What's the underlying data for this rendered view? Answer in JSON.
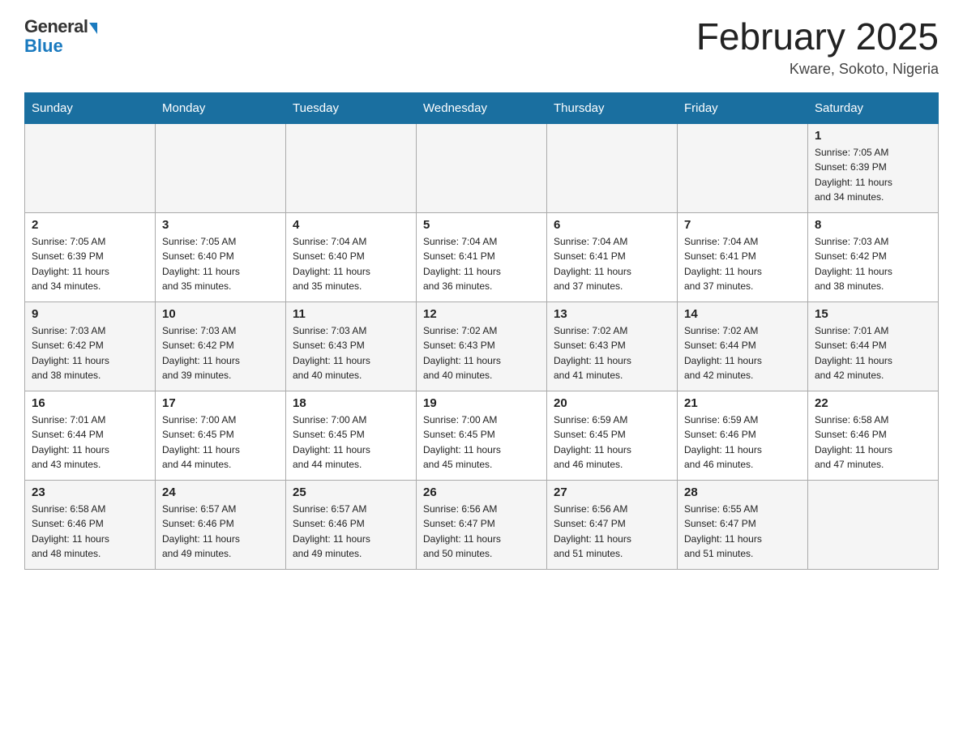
{
  "header": {
    "logo_general": "General",
    "logo_blue": "Blue",
    "title": "February 2025",
    "subtitle": "Kware, Sokoto, Nigeria"
  },
  "days_of_week": [
    "Sunday",
    "Monday",
    "Tuesday",
    "Wednesday",
    "Thursday",
    "Friday",
    "Saturday"
  ],
  "weeks": [
    {
      "row_class": "row-odd",
      "days": [
        {
          "num": "",
          "info": ""
        },
        {
          "num": "",
          "info": ""
        },
        {
          "num": "",
          "info": ""
        },
        {
          "num": "",
          "info": ""
        },
        {
          "num": "",
          "info": ""
        },
        {
          "num": "",
          "info": ""
        },
        {
          "num": "1",
          "info": "Sunrise: 7:05 AM\nSunset: 6:39 PM\nDaylight: 11 hours\nand 34 minutes."
        }
      ]
    },
    {
      "row_class": "row-even",
      "days": [
        {
          "num": "2",
          "info": "Sunrise: 7:05 AM\nSunset: 6:39 PM\nDaylight: 11 hours\nand 34 minutes."
        },
        {
          "num": "3",
          "info": "Sunrise: 7:05 AM\nSunset: 6:40 PM\nDaylight: 11 hours\nand 35 minutes."
        },
        {
          "num": "4",
          "info": "Sunrise: 7:04 AM\nSunset: 6:40 PM\nDaylight: 11 hours\nand 35 minutes."
        },
        {
          "num": "5",
          "info": "Sunrise: 7:04 AM\nSunset: 6:41 PM\nDaylight: 11 hours\nand 36 minutes."
        },
        {
          "num": "6",
          "info": "Sunrise: 7:04 AM\nSunset: 6:41 PM\nDaylight: 11 hours\nand 37 minutes."
        },
        {
          "num": "7",
          "info": "Sunrise: 7:04 AM\nSunset: 6:41 PM\nDaylight: 11 hours\nand 37 minutes."
        },
        {
          "num": "8",
          "info": "Sunrise: 7:03 AM\nSunset: 6:42 PM\nDaylight: 11 hours\nand 38 minutes."
        }
      ]
    },
    {
      "row_class": "row-odd",
      "days": [
        {
          "num": "9",
          "info": "Sunrise: 7:03 AM\nSunset: 6:42 PM\nDaylight: 11 hours\nand 38 minutes."
        },
        {
          "num": "10",
          "info": "Sunrise: 7:03 AM\nSunset: 6:42 PM\nDaylight: 11 hours\nand 39 minutes."
        },
        {
          "num": "11",
          "info": "Sunrise: 7:03 AM\nSunset: 6:43 PM\nDaylight: 11 hours\nand 40 minutes."
        },
        {
          "num": "12",
          "info": "Sunrise: 7:02 AM\nSunset: 6:43 PM\nDaylight: 11 hours\nand 40 minutes."
        },
        {
          "num": "13",
          "info": "Sunrise: 7:02 AM\nSunset: 6:43 PM\nDaylight: 11 hours\nand 41 minutes."
        },
        {
          "num": "14",
          "info": "Sunrise: 7:02 AM\nSunset: 6:44 PM\nDaylight: 11 hours\nand 42 minutes."
        },
        {
          "num": "15",
          "info": "Sunrise: 7:01 AM\nSunset: 6:44 PM\nDaylight: 11 hours\nand 42 minutes."
        }
      ]
    },
    {
      "row_class": "row-even",
      "days": [
        {
          "num": "16",
          "info": "Sunrise: 7:01 AM\nSunset: 6:44 PM\nDaylight: 11 hours\nand 43 minutes."
        },
        {
          "num": "17",
          "info": "Sunrise: 7:00 AM\nSunset: 6:45 PM\nDaylight: 11 hours\nand 44 minutes."
        },
        {
          "num": "18",
          "info": "Sunrise: 7:00 AM\nSunset: 6:45 PM\nDaylight: 11 hours\nand 44 minutes."
        },
        {
          "num": "19",
          "info": "Sunrise: 7:00 AM\nSunset: 6:45 PM\nDaylight: 11 hours\nand 45 minutes."
        },
        {
          "num": "20",
          "info": "Sunrise: 6:59 AM\nSunset: 6:45 PM\nDaylight: 11 hours\nand 46 minutes."
        },
        {
          "num": "21",
          "info": "Sunrise: 6:59 AM\nSunset: 6:46 PM\nDaylight: 11 hours\nand 46 minutes."
        },
        {
          "num": "22",
          "info": "Sunrise: 6:58 AM\nSunset: 6:46 PM\nDaylight: 11 hours\nand 47 minutes."
        }
      ]
    },
    {
      "row_class": "row-odd",
      "days": [
        {
          "num": "23",
          "info": "Sunrise: 6:58 AM\nSunset: 6:46 PM\nDaylight: 11 hours\nand 48 minutes."
        },
        {
          "num": "24",
          "info": "Sunrise: 6:57 AM\nSunset: 6:46 PM\nDaylight: 11 hours\nand 49 minutes."
        },
        {
          "num": "25",
          "info": "Sunrise: 6:57 AM\nSunset: 6:46 PM\nDaylight: 11 hours\nand 49 minutes."
        },
        {
          "num": "26",
          "info": "Sunrise: 6:56 AM\nSunset: 6:47 PM\nDaylight: 11 hours\nand 50 minutes."
        },
        {
          "num": "27",
          "info": "Sunrise: 6:56 AM\nSunset: 6:47 PM\nDaylight: 11 hours\nand 51 minutes."
        },
        {
          "num": "28",
          "info": "Sunrise: 6:55 AM\nSunset: 6:47 PM\nDaylight: 11 hours\nand 51 minutes."
        },
        {
          "num": "",
          "info": ""
        }
      ]
    }
  ]
}
